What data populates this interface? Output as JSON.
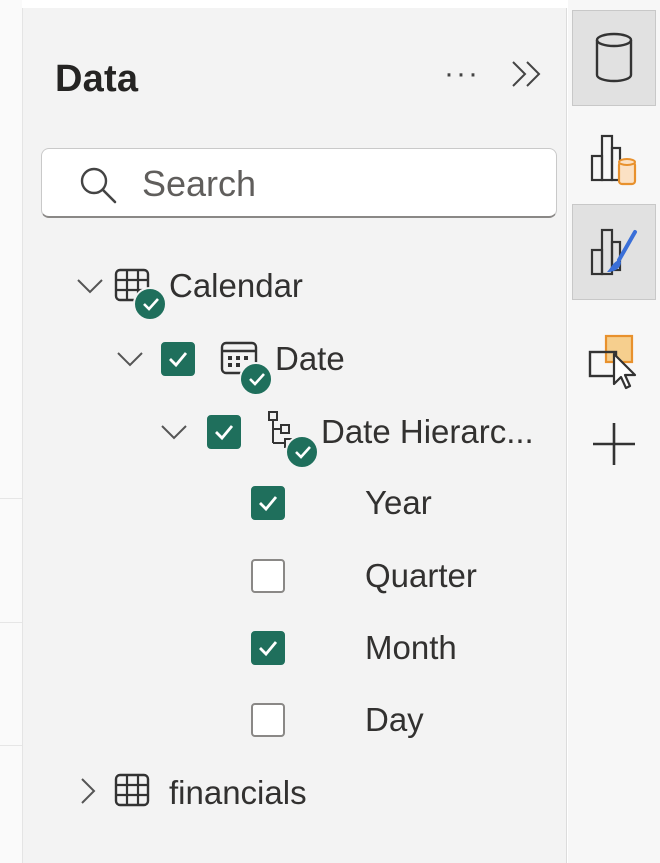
{
  "pane": {
    "title": "Data",
    "more_label": "···"
  },
  "search": {
    "placeholder": "Search"
  },
  "tree": {
    "calendar": {
      "label": "Calendar",
      "expanded": true
    },
    "date": {
      "label": "Date",
      "expanded": true,
      "checked": true
    },
    "hierarchy": {
      "label": "Date Hierarc...",
      "expanded": true,
      "checked": true
    },
    "levels": [
      {
        "label": "Year",
        "checked": true
      },
      {
        "label": "Quarter",
        "checked": false
      },
      {
        "label": "Month",
        "checked": true
      },
      {
        "label": "Day",
        "checked": false
      }
    ],
    "financials": {
      "label": "financials",
      "expanded": false
    }
  },
  "rail": {
    "items": [
      {
        "icon": "database-icon",
        "active": true
      },
      {
        "icon": "build-visual-icon",
        "active": false
      },
      {
        "icon": "format-visual-icon",
        "active": true
      },
      {
        "icon": "select-visual-icon",
        "active": false
      },
      {
        "icon": "add-icon",
        "active": false
      }
    ]
  },
  "colors": {
    "accent": "#1f6f5c",
    "pane_bg": "#f3f3f3",
    "rail_active": "#e1e1e1",
    "orange_accent": "#e8912d"
  }
}
